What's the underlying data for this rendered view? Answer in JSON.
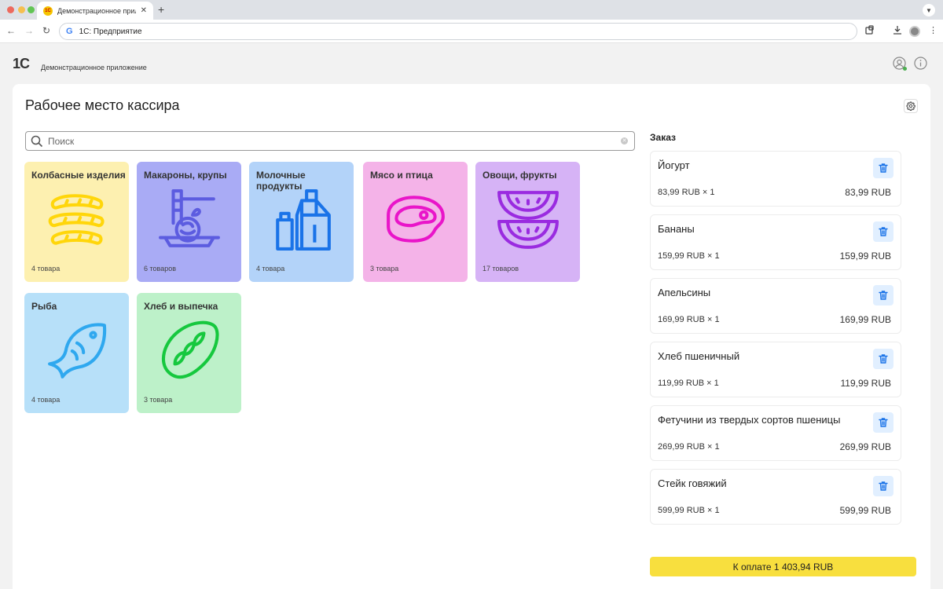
{
  "browser": {
    "tab_title": "Демонстрационное прилож",
    "tab_favicon": "1С",
    "url": "1С: Предприятие",
    "search_engine_glyph": "G",
    "traffic_colors": [
      "#ed6a5e",
      "#f5bf4f",
      "#62c554"
    ]
  },
  "app": {
    "logo": "1С",
    "title": "Демонстрационное приложение"
  },
  "page": {
    "title": "Рабочее место кассира"
  },
  "search": {
    "placeholder": "Поиск"
  },
  "categories": [
    {
      "name": "Колбасные изделия",
      "count": "4 товара",
      "color": "#fdf0b0",
      "icon_color": "#ffd60a",
      "icon": "sausage-icon"
    },
    {
      "name": "Макароны, крупы",
      "count": "6 товаров",
      "color": "#a9abf5",
      "icon_color": "#5c5ce0",
      "icon": "pasta-icon"
    },
    {
      "name": "Молочные продукты",
      "count": "4 товара",
      "color": "#b3d3f9",
      "icon_color": "#1a73e8",
      "icon": "milk-icon"
    },
    {
      "name": "Мясо и птица",
      "count": "3 товара",
      "color": "#f4b3e8",
      "icon_color": "#e915c9",
      "icon": "steak-icon"
    },
    {
      "name": "Овощи, фрукты",
      "count": "17 товаров",
      "color": "#d6b3f6",
      "icon_color": "#9a2be0",
      "icon": "watermelon-icon"
    },
    {
      "name": "Рыба",
      "count": "4 товара",
      "color": "#b7e0f9",
      "icon_color": "#2fa8ef",
      "icon": "fish-icon"
    },
    {
      "name": "Хлеб и выпечка",
      "count": "3 товара",
      "color": "#bdf1c9",
      "icon_color": "#16c83e",
      "icon": "bread-icon"
    }
  ],
  "order": {
    "title": "Заказ",
    "items": [
      {
        "name": "Йогурт",
        "line": "83,99 RUB × 1",
        "sum": "83,99 RUB"
      },
      {
        "name": "Бананы",
        "line": "159,99 RUB × 1",
        "sum": "159,99 RUB"
      },
      {
        "name": "Апельсины",
        "line": "169,99 RUB × 1",
        "sum": "169,99 RUB"
      },
      {
        "name": "Хлеб пшеничный",
        "line": "119,99 RUB × 1",
        "sum": "119,99 RUB"
      },
      {
        "name": "Фетучини из твердых сортов пшеницы",
        "line": "269,99 RUB × 1",
        "sum": "269,99 RUB"
      },
      {
        "name": "Стейк говяжий",
        "line": "599,99 RUB × 1",
        "sum": "599,99 RUB"
      }
    ],
    "pay_label": "К оплате 1 403,94 RUB",
    "accent": "#f8df3e",
    "delete_color": "#1a73e8"
  }
}
